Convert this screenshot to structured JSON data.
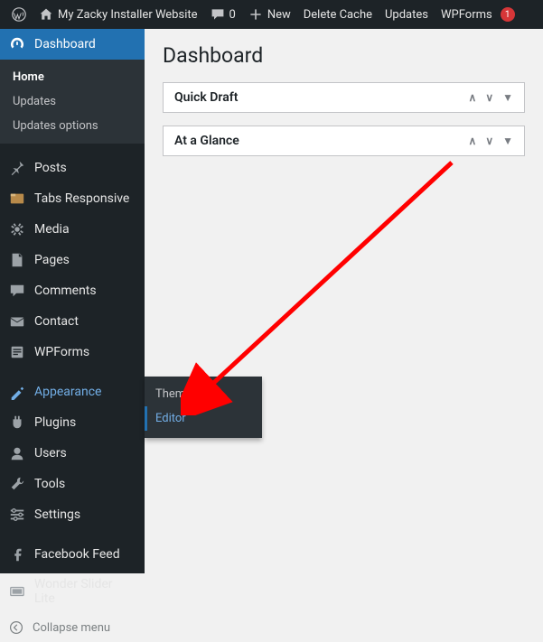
{
  "adminbar": {
    "site_name": "My Zacky Installer Website",
    "comments_count": "0",
    "new_label": "New",
    "delete_cache": "Delete Cache",
    "updates": "Updates",
    "wpforms_label": "WPForms",
    "wpforms_count": "1"
  },
  "sidebar": {
    "dashboard": "Dashboard",
    "dashboard_sub": [
      "Home",
      "Updates",
      "Updates options"
    ],
    "posts": "Posts",
    "tabs_responsive": "Tabs Responsive",
    "media": "Media",
    "pages": "Pages",
    "comments": "Comments",
    "contact": "Contact",
    "wpforms": "WPForms",
    "appearance": "Appearance",
    "plugins": "Plugins",
    "users": "Users",
    "tools": "Tools",
    "settings": "Settings",
    "facebook_feed": "Facebook Feed",
    "wonder_slider": "Wonder Slider Lite",
    "collapse": "Collapse menu"
  },
  "appearance_flyout": {
    "themes": "Themes",
    "editor": "Editor"
  },
  "main": {
    "title": "Dashboard",
    "quick_draft": "Quick Draft",
    "at_a_glance": "At a Glance"
  }
}
